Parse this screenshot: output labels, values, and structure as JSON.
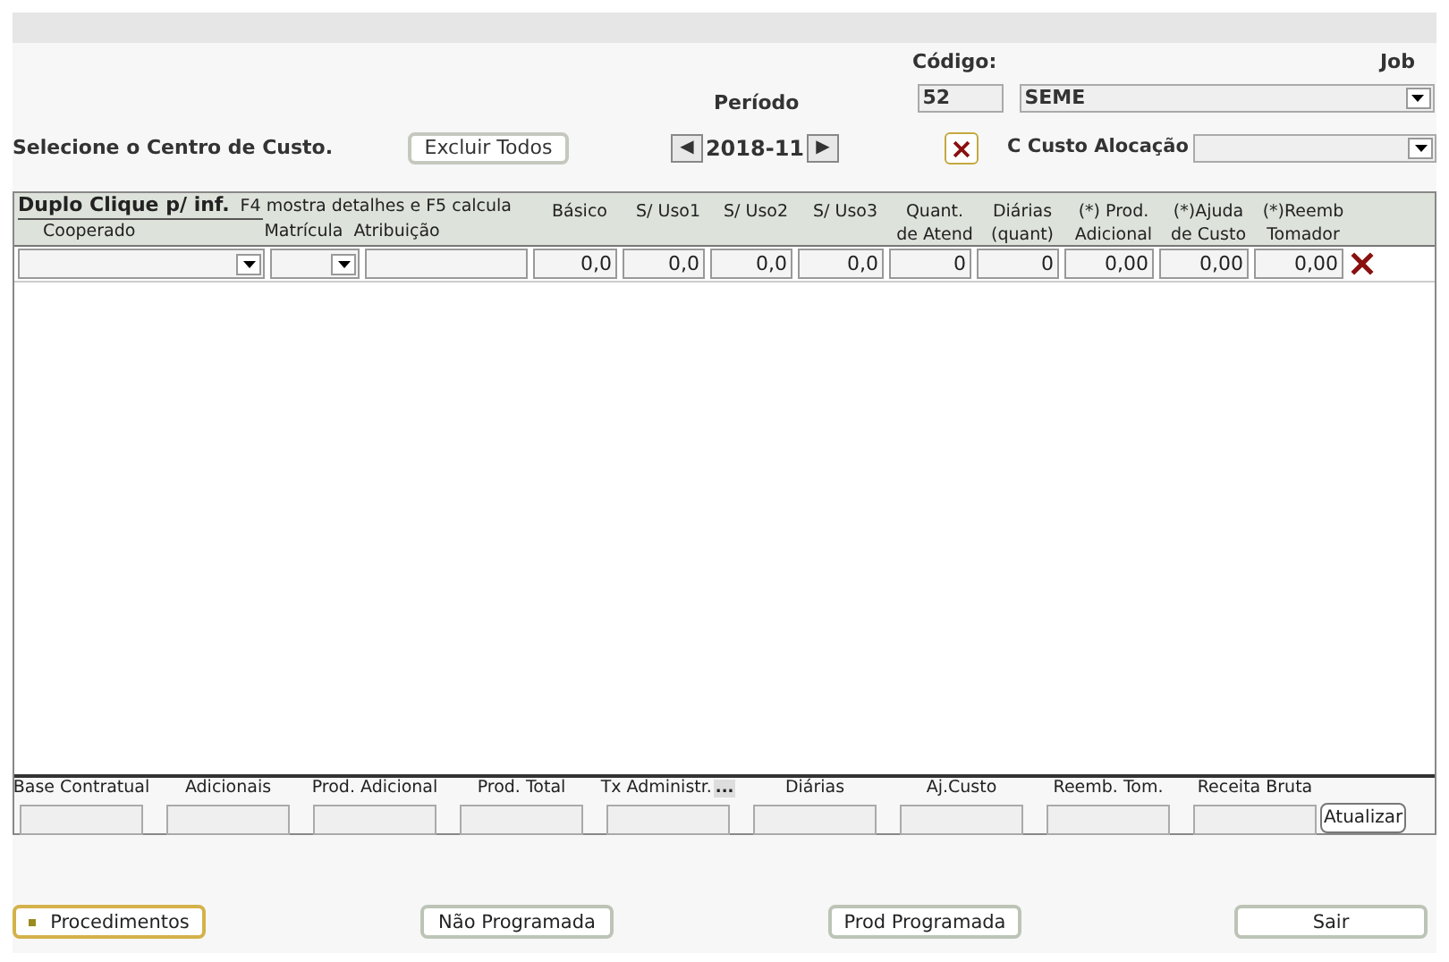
{
  "top": {
    "codigo_label": "Código:",
    "job_label": "Job",
    "periodo_label": "Período",
    "codigo_value": "52",
    "job_value": "SEME",
    "centro_label": "Selecione o Centro de Custo.",
    "excluir_button": "Excluir Todos",
    "period_prev": "◀",
    "period_value": "2018-11",
    "period_next": "▶",
    "alocacao_label": "C Custo Alocação"
  },
  "grid": {
    "hint": "Duplo Clique p/ inf.",
    "keys_hint": "F4 mostra detalhes e F5 calcula",
    "left_columns": [
      "Cooperado",
      "Matrícula",
      "Atribuição"
    ],
    "columns": [
      {
        "line1": "Básico"
      },
      {
        "line1": "S/ Uso1"
      },
      {
        "line1": "S/ Uso2"
      },
      {
        "line1": "S/ Uso3"
      },
      {
        "line1": "Quant.",
        "line2": "de Atend"
      },
      {
        "line1": "Diárias",
        "line2": "(quant)"
      },
      {
        "line1": "(*) Prod.",
        "line2": "Adicional"
      },
      {
        "line1": "(*)Ajuda",
        "line2": "de Custo"
      },
      {
        "line1": "(*)Reemb",
        "line2": "Tomador"
      }
    ],
    "row": [
      "0,0",
      "0,0",
      "0,0",
      "0,0",
      "0",
      "0",
      "0,00",
      "0,00",
      "0,00"
    ]
  },
  "totals": {
    "fields": [
      "Base Contratual",
      "Adicionais",
      "Prod. Adicional",
      "Prod. Total",
      "Tx Administr.",
      "Diárias",
      "Aj.Custo",
      "Reemb. Tom.",
      "Receita Bruta"
    ],
    "more_button": "...",
    "update_button": "Atualizar"
  },
  "buttons": [
    {
      "label": "Procedimentos",
      "selected": true
    },
    {
      "label": "Não Programada",
      "selected": false
    },
    {
      "label": "Prod Programada",
      "selected": false
    },
    {
      "label": "Sair",
      "selected": false
    }
  ]
}
